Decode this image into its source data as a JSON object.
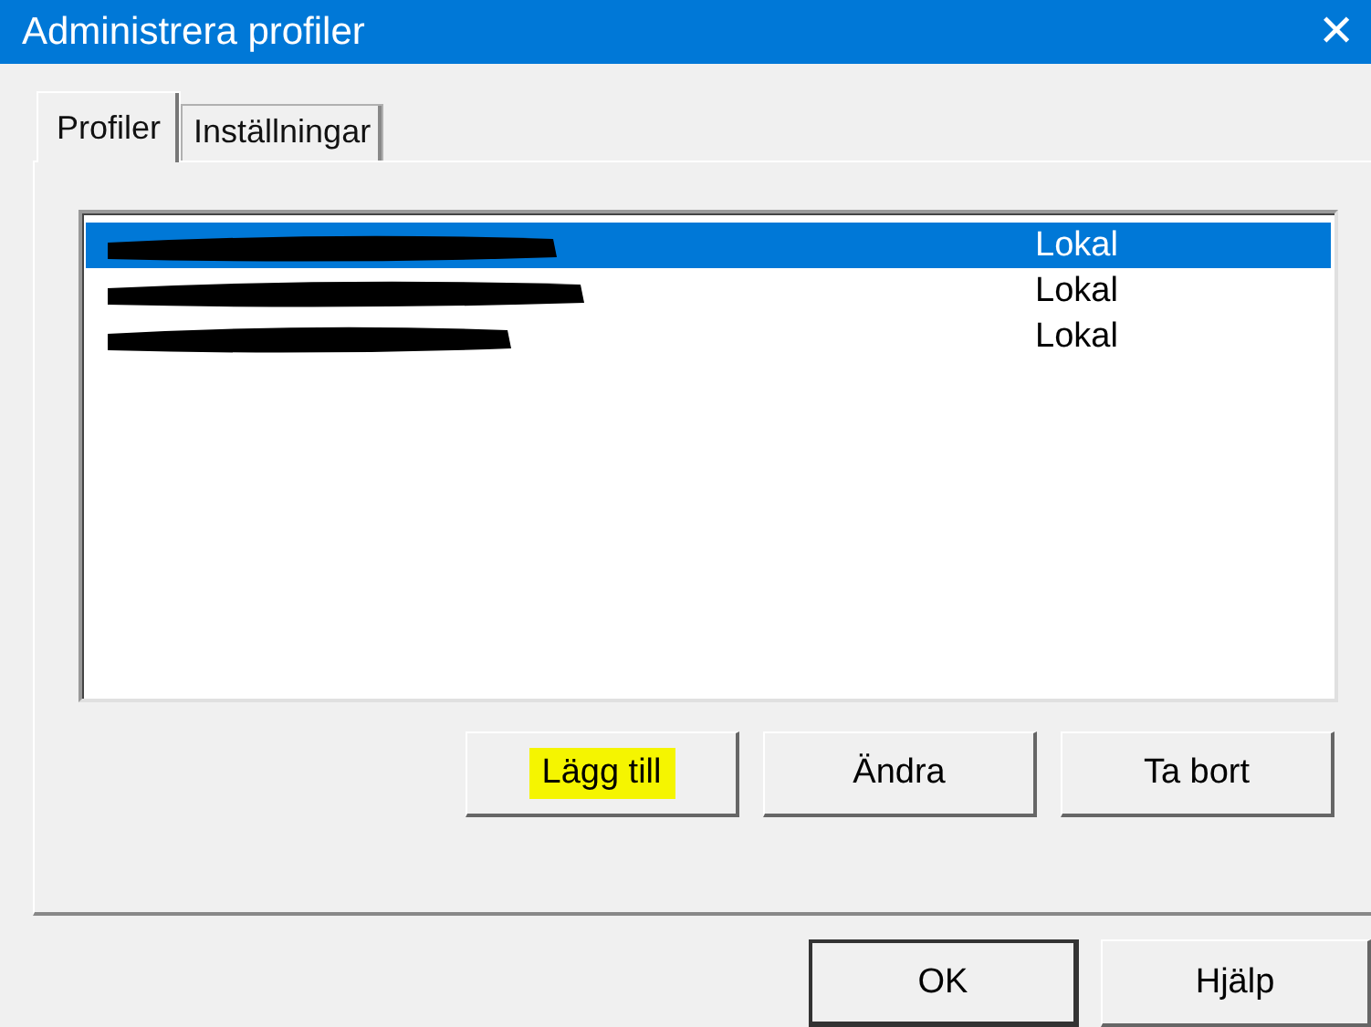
{
  "window": {
    "title": "Administrera profiler",
    "close": "✕"
  },
  "tabs": [
    {
      "label": "Profiler",
      "selected": true
    },
    {
      "label": "Inställningar",
      "selected": false
    }
  ],
  "profiles": [
    {
      "redacted": true,
      "location": "Lokal",
      "selected": true
    },
    {
      "redacted": true,
      "location": "Lokal",
      "selected": false
    },
    {
      "redacted": true,
      "location": "Lokal",
      "selected": false
    }
  ],
  "list_buttons": [
    {
      "label": "Lägg till",
      "highlighted": true
    },
    {
      "label": "Ändra",
      "highlighted": false
    },
    {
      "label": "Ta bort",
      "highlighted": false
    }
  ],
  "dialog_buttons": [
    {
      "label": "OK",
      "default": true
    },
    {
      "label": "Hjälp",
      "default": false
    }
  ]
}
